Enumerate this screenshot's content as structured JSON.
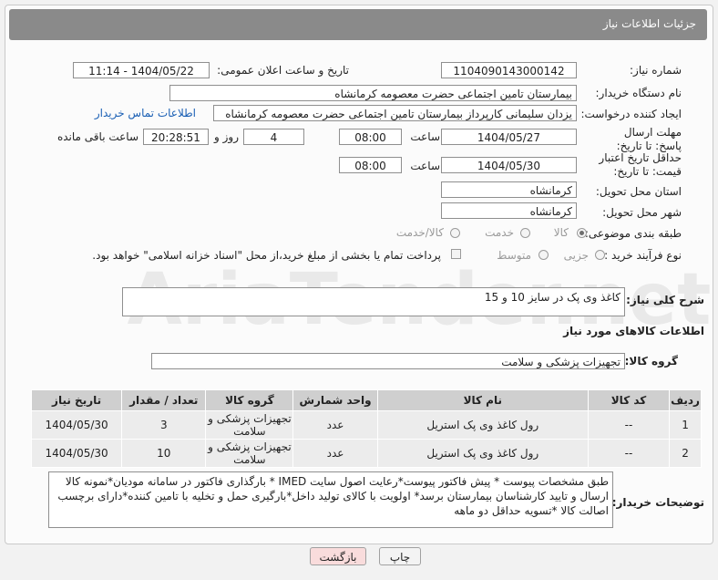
{
  "header": {
    "title": "جزئیات اطلاعات نیاز"
  },
  "form": {
    "need_number_label": "شماره نیاز:",
    "need_number": "1104090143000142",
    "announce_label": "تاریخ و ساعت اعلان عمومی:",
    "announce_value": "1404/05/22 - 11:14",
    "buyer_org_label": "نام دستگاه خریدار:",
    "buyer_org": "بیمارستان تامین اجتماعی حضرت معصومه کرمانشاه",
    "creator_label": "ایجاد کننده درخواست:",
    "creator": "یزدان  سلیمانی کارپرداز بیمارستان تامین اجتماعی حضرت معصومه کرمانشاه",
    "contact_link": "اطلاعات تماس خریدار",
    "deadline_label": "مهلت ارسال پاسخ: تا تاریخ:",
    "deadline_date": "1404/05/27",
    "time_label": "ساعت",
    "deadline_time": "08:00",
    "days_value": "4",
    "days_label": "روز و",
    "remaining_time": "20:28:51",
    "remaining_label": "ساعت باقی مانده",
    "price_validity_label": "حداقل تاریخ اعتبار قیمت: تا تاریخ:",
    "price_validity_date": "1404/05/30",
    "price_validity_time": "08:00",
    "province_label": "استان محل تحویل:",
    "province": "کرمانشاه",
    "city_label": "شهر محل تحویل:",
    "city": "کرمانشاه",
    "category_label": "طبقه بندی موضوعی:",
    "category_options": [
      "کالا",
      "خدمت",
      "کالا/خدمت"
    ],
    "category_selected": "کالا",
    "process_label": "نوع فرآیند خرید :",
    "process_options": [
      "جزیی",
      "متوسط"
    ],
    "payment_note": "پرداخت تمام یا بخشی از مبلغ خرید،از محل \"اسناد خزانه اسلامی\" خواهد بود."
  },
  "description": {
    "label": "شرح کلی نیاز:",
    "value": "کاغذ وی پک در سایز 10 و 15"
  },
  "goods": {
    "section_title": "اطلاعات کالاهای مورد نیاز",
    "group_label": "گروه کالا:",
    "group_value": "تجهیزات پزشکی و سلامت",
    "columns": [
      "ردیف",
      "کد کالا",
      "نام کالا",
      "واحد شمارش",
      "گروه کالا",
      "تعداد / مقدار",
      "تاریخ نیاز"
    ],
    "rows": [
      [
        "1",
        "--",
        "رول کاغذ وی پک استریل",
        "عدد",
        "تجهیزات پزشکی و سلامت",
        "3",
        "1404/05/30"
      ],
      [
        "2",
        "--",
        "رول کاغذ وی پک استریل",
        "عدد",
        "تجهیزات پزشکی و سلامت",
        "10",
        "1404/05/30"
      ]
    ]
  },
  "buyer_notes": {
    "label": "توضیحات خریدار:",
    "value": "طبق مشخصات پیوست * پیش فاکتور پیوست*رعایت اصول سایت IMED * بارگذاری فاکتور در سامانه مودیان*نمونه کالا ارسال و تایید کارشناسان بیمارستان برسد* اولویت با کالای تولید داخل*بارگیری حمل و تخلیه با تامین کننده*دارای برچسب اصالت کالا *تسویه حداقل دو ماهه"
  },
  "buttons": {
    "print": "چاپ",
    "back": "بازگشت"
  },
  "watermark": {
    "text": "AriaTender.net"
  },
  "colors": {
    "header_bg": "#8a8a8a",
    "link": "#1a5fb4",
    "back_button_bg": "#f9dcdc"
  }
}
